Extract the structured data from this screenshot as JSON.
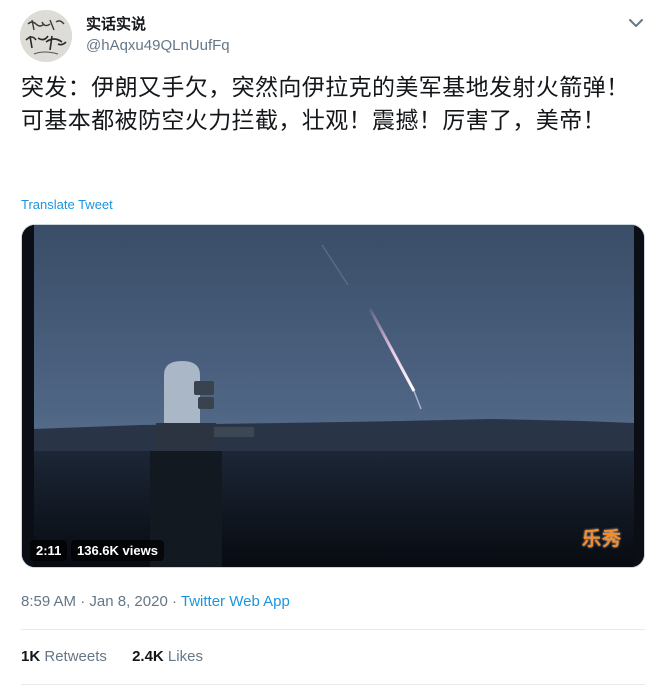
{
  "user": {
    "display_name": "实话实说",
    "handle": "@hAqxu49QLnUufFq",
    "avatar_text": "实话实说",
    "menu_icon": "chevron-down-icon"
  },
  "tweet": {
    "text": "突发：伊朗又手欠，突然向伊拉克的美军基地发射火箭弹！ 可基本都被防空火力拦截，壮观！震撼！厉害了，美帝！",
    "translate_label": "Translate Tweet"
  },
  "media": {
    "type": "video",
    "duration": "2:11",
    "views": "136.6K views",
    "watermark": "乐秀"
  },
  "meta": {
    "time": "8:59 AM",
    "separator": "·",
    "date": "Jan 8, 2020",
    "source": "Twitter Web App"
  },
  "stats": {
    "retweets_count": "1K",
    "retweets_label": "Retweets",
    "likes_count": "2.4K",
    "likes_label": "Likes"
  },
  "colors": {
    "link": "#1b95e0",
    "secondary_text": "#657786",
    "primary_text": "#14171a",
    "divider": "#e6ecf0"
  }
}
